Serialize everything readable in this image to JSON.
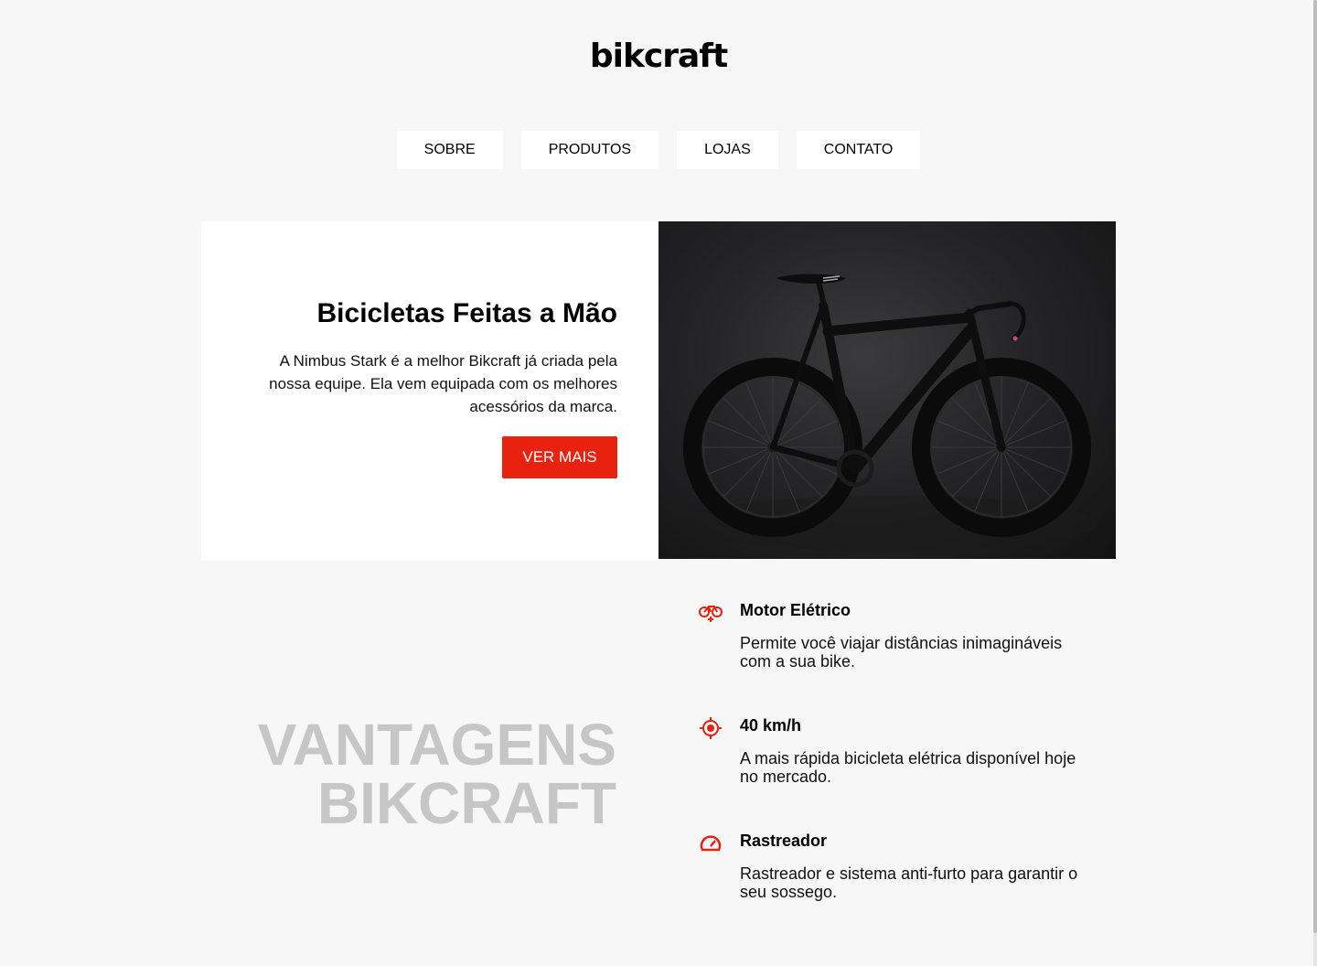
{
  "brand": {
    "logo": "bikcraft"
  },
  "nav": {
    "items": [
      "SOBRE",
      "PRODUTOS",
      "LOJAS",
      "CONTATO"
    ]
  },
  "hero": {
    "title": "Bicicletas Feitas a Mão",
    "description": "A Nimbus Stark é a melhor Bikcraft já criada pela nossa equipe. Ela vem equipada com os melhores acessórios da marca.",
    "button_label": "VER MAIS"
  },
  "vantagens": {
    "line1": "VANTAGENS",
    "line2": "BIKCRAFT"
  },
  "features": [
    {
      "icon": "electric-bike-icon",
      "title": "Motor Elétrico",
      "text": "Permite você viajar distâncias inimagináveis com a sua bike."
    },
    {
      "icon": "target-icon",
      "title": "40 km/h",
      "text": "A mais rápida bicicleta elétrica disponível hoje no mercado."
    },
    {
      "icon": "speedometer-icon",
      "title": "Rastreador",
      "text": "Rastreador e sistema anti-furto para garantir o seu sossego."
    }
  ],
  "colors": {
    "accent": "#e8220f",
    "background": "#f7f7f7",
    "muted_heading": "#c6c6c6"
  }
}
